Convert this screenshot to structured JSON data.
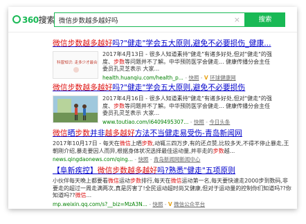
{
  "logo": {
    "num": "360",
    "text": "搜索"
  },
  "search": {
    "query": "微信步数越多越好吗",
    "button_label": "搜索",
    "clear": "×"
  },
  "results": [
    {
      "title": "微信步数越多越好吗?\"健走\"学会五大原则,避免不必要损伤_健康...",
      "lines": [
        "2017年4月13日 - 很多人知道素持\"健走\"有诸多好处,但对\"健走\"的强",
        "度、步数等问题并不了解。中华预防医学会健走... 健康传播分会主任",
        "委员孔灵芝表示 大家..."
      ],
      "url": "health.huanqiu.com/health_p...",
      "snapshot": "快照",
      "source": "环球健康网",
      "thumb_caption": "科普知识: 走多少才最合适"
    },
    {
      "title": "微信步数越多越好吗?\"健走\"学会五大原则,避免不必要损伤",
      "lines": [
        "2017年4月16日 - 很多人知道素持\"健走\"有诸多好处,但对\"健走\"的强",
        "度、步数等问题并不了解。中华预防医学会健走... 健康传播分会主任",
        "委员孔灵芝表示 大家..."
      ],
      "url": "www.toutiao.com/i6409495307...",
      "snapshot": "快照",
      "source": "今日头条"
    },
    {
      "title": "微信晒步数并非越多越好方法不当健走易受伤-青岛新闻网",
      "snippet": "2017年10月17日 - 每天在微信上晒步数,动辄三四万步,有的还点赞,比较多天,不得不停止暴走,王朝刚介绍,暴走要因人而异,根据身体状况选择最佳运动量,并非走的步数越...",
      "url": "news.qingdaonews.com/qing...",
      "snapshot": "快照",
      "source": "青岛新闻网新闻中心"
    },
    {
      "title": "【阜新疾控】微信步数越多越好吗?熟悉\"健走\"五项原则",
      "snippet": "小伙伴每天晚上都要看微信运动步数排行,每天在微信运动第一名,每天要快速走2000步到数码,非要走的超过一周走满两次,真是厉害了!全民运动超时尚又健康,但对于运动量的控制你们知道吗??你知道吗??微信...",
      "url": "mp.weixin.qq.com/s?__biz=MzA3N...",
      "snapshot": "快照",
      "source": "微信公众平台"
    }
  ]
}
